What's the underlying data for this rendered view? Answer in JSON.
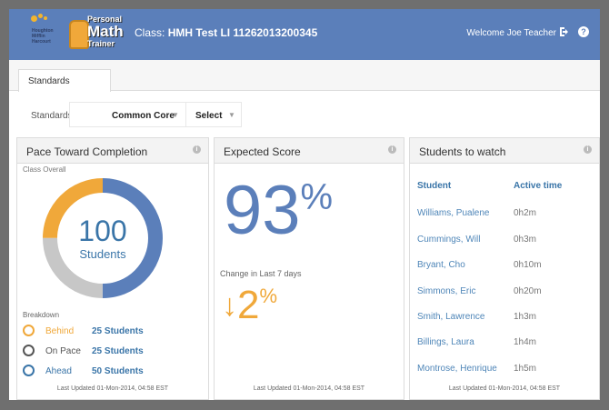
{
  "header": {
    "logo_text": "Houghton Mifflin Harcourt",
    "app_name_top": "Personal",
    "app_name_mid": "Math",
    "app_name_bottom": "Trainer",
    "class_prefix": "Class: ",
    "class_name": "HMH Test LI 11262013200345",
    "welcome": "Welcome Joe Teacher",
    "logout_icon": "logout-icon",
    "help_icon": "help-icon"
  },
  "tabs": [
    {
      "label": "Standards",
      "active": true
    }
  ],
  "filters": {
    "label": "Standards",
    "standard_value": "Common Core",
    "select_value": "Select"
  },
  "pace": {
    "title": "Pace Toward Completion",
    "class_overall": "Class Overall",
    "total": "100",
    "total_label": "Students",
    "donut": [
      {
        "name": "Ahead",
        "fraction": 0.5,
        "color": "#5b7fba"
      },
      {
        "name": "On Pace",
        "fraction": 0.25,
        "color": "#c7c7c7"
      },
      {
        "name": "Behind",
        "fraction": 0.25,
        "color": "#f0a83a"
      }
    ],
    "breakdown_title": "Breakdown",
    "breakdown": [
      {
        "name": "Behind",
        "count": "25 Students",
        "color": "#f0a83a"
      },
      {
        "name": "On Pace",
        "count": "25 Students",
        "color": "#555555"
      },
      {
        "name": "Ahead",
        "count": "50 Students",
        "color": "#3a75a8"
      }
    ],
    "updated": "Last Updated 01-Mon-2014, 04:58 EST"
  },
  "score": {
    "title": "Expected Score",
    "value": "93",
    "pct": "%",
    "change_label": "Change in Last 7 days",
    "change_value": "2",
    "change_arrow": "↓",
    "updated": "Last Updated 01-Mon-2014, 04:58 EST"
  },
  "watch": {
    "title": "Students to watch",
    "col_student": "Student",
    "col_time": "Active time",
    "rows": [
      {
        "name": "Williams, Pualene",
        "time": "0h2m"
      },
      {
        "name": "Cummings, Will",
        "time": "0h3m"
      },
      {
        "name": "Bryant, Cho",
        "time": "0h10m"
      },
      {
        "name": "Simmons, Eric",
        "time": "0h20m"
      },
      {
        "name": "Smith, Lawrence",
        "time": "1h3m"
      },
      {
        "name": "Billings, Laura",
        "time": "1h4m"
      },
      {
        "name": "Montrose, Henrique",
        "time": "1h5m"
      }
    ],
    "updated": "Last Updated 01-Mon-2014, 04:58 EST"
  },
  "info_icon": "info-icon"
}
